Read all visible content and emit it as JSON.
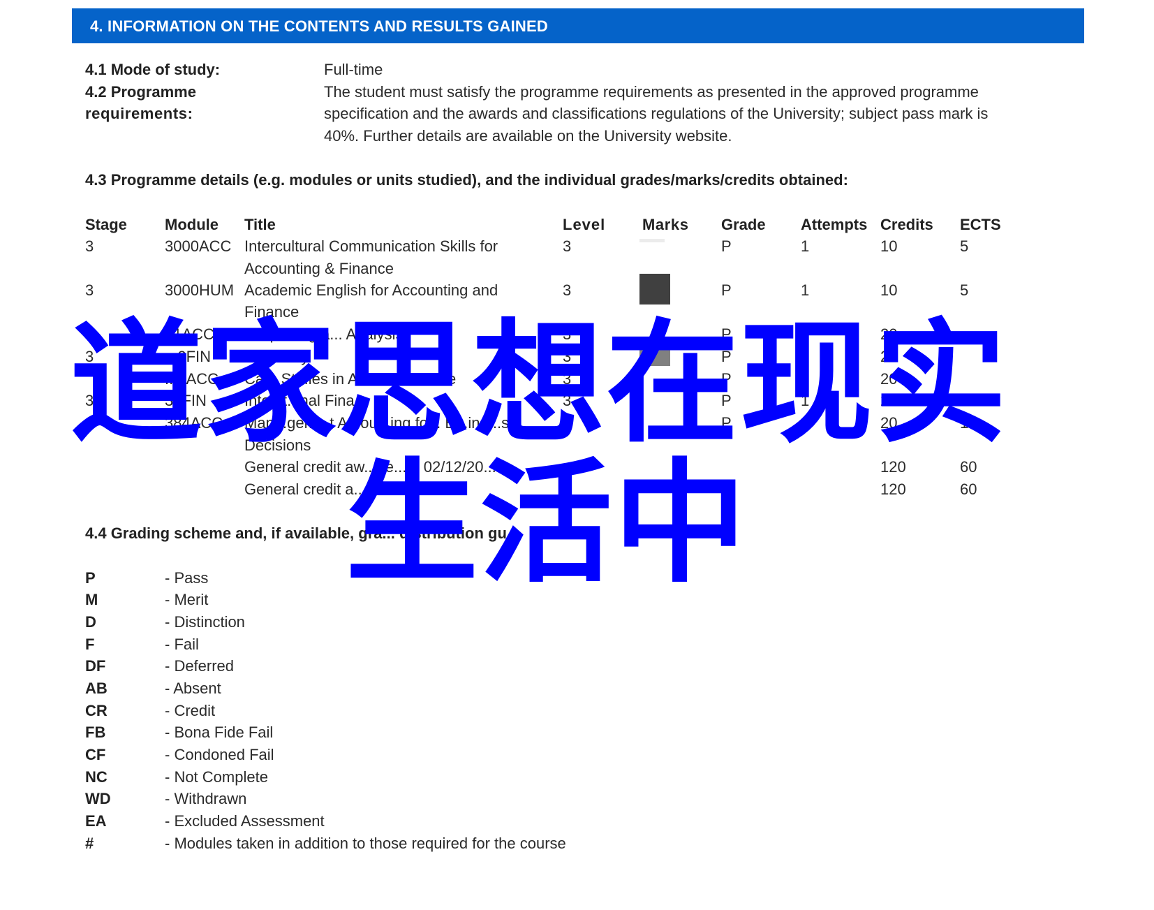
{
  "header": {
    "title": "4. INFORMATION ON THE CONTENTS AND RESULTS GAINED",
    "bar_color": "#0563c9"
  },
  "mode_of_study": {
    "label": "4.1 Mode of study:",
    "value": "Full-time"
  },
  "programme_requirements": {
    "label_line1": "4.2 Programme",
    "label_line2": "requirements:",
    "lines": [
      "The student must satisfy the programme requirements as presented in the approved programme",
      "specification and the awards and classifications regulations of the University; subject pass mark is",
      "40%. Further details are available on the University website."
    ]
  },
  "programme_details": {
    "heading": "4.3 Programme details (e.g. modules or units studied), and the individual grades/marks/credits obtained:",
    "columns": [
      "Stage",
      "Module",
      "Title",
      "Level",
      "Marks",
      "Grade",
      "Attempts",
      "Credits",
      "ECTS"
    ],
    "rows": [
      {
        "stage": "3",
        "module": "3000ACC",
        "title_lines": [
          "Intercultural Communication Skills for",
          "Accounting & Finance"
        ],
        "level": "3",
        "marks": "",
        "grade": "P",
        "attempts": "1",
        "credits": "10",
        "ects": "5"
      },
      {
        "stage": "3",
        "module": "3000HUM",
        "title_lines": [
          "Academic English for Accounting and",
          "Finance"
        ],
        "level": "3",
        "marks": "",
        "grade": "P",
        "attempts": "1",
        "credits": "10",
        "ects": "5"
      },
      {
        "stage": "",
        "module": "..1ACC",
        "title_lines": [
          "... eporting a... Analysis"
        ],
        "level": "3",
        "marks": "",
        "grade": "P",
        "attempts": "",
        "credits": "20",
        "ects": ""
      },
      {
        "stage": "3",
        "module": "...2FIN",
        "title_lines": [
          "... Theory"
        ],
        "level": "3",
        "marks": "",
        "grade": "P",
        "attempts": "1",
        "credits": "20",
        "ects": ""
      },
      {
        "stage": "",
        "module": "...3ACC",
        "title_lines": [
          "Ca... St...ies in A... ...d Fi...n...e"
        ],
        "level": "3",
        "marks": "",
        "grade": "P",
        "attempts": "1",
        "credits": "20",
        "ects": ""
      },
      {
        "stage": "3",
        "module": "3..FIN",
        "title_lines": [
          "Inte...t...nal Fina..."
        ],
        "level": "3",
        "marks": "",
        "grade": "P",
        "attempts": "1",
        "credits": "20",
        "ects": ""
      },
      {
        "stage": "",
        "module": "384ACC",
        "title_lines": [
          "Man...gem...t A...ou...ing fo... B...ine...s",
          "Decisions"
        ],
        "level": "3",
        "marks": "",
        "grade": "P",
        "attempts": "1",
        "credits": "20",
        "ects": "10"
      }
    ],
    "summary_rows": [
      {
        "title": "General credit aw...de... n 02/12/20...",
        "credits": "120",
        "ects": "60"
      },
      {
        "title": "General credit a... ...2/2019",
        "credits": "120",
        "ects": "60"
      }
    ]
  },
  "grading_scheme": {
    "heading": "4.4 Grading scheme and, if available, gra... distribution gu...",
    "items": [
      {
        "code": "P",
        "desc": "- Pass"
      },
      {
        "code": "M",
        "desc": "- Merit"
      },
      {
        "code": "D",
        "desc": "- Distinction"
      },
      {
        "code": "F",
        "desc": "- Fail"
      },
      {
        "code": "DF",
        "desc": "- Deferred"
      },
      {
        "code": "AB",
        "desc": "- Absent"
      },
      {
        "code": "CR",
        "desc": "- Credit"
      },
      {
        "code": "FB",
        "desc": "- Bona Fide Fail"
      },
      {
        "code": "CF",
        "desc": "- Condoned Fail"
      },
      {
        "code": "NC",
        "desc": "- Not Complete"
      },
      {
        "code": "WD",
        "desc": "- Withdrawn"
      },
      {
        "code": "EA",
        "desc": "- Excluded Assessment"
      },
      {
        "code": "#",
        "desc": "- Modules taken in addition to those required for the course"
      }
    ]
  },
  "watermark": {
    "line1": "道家思想在现实",
    "line2": "生活中",
    "color": "#0000ff"
  }
}
